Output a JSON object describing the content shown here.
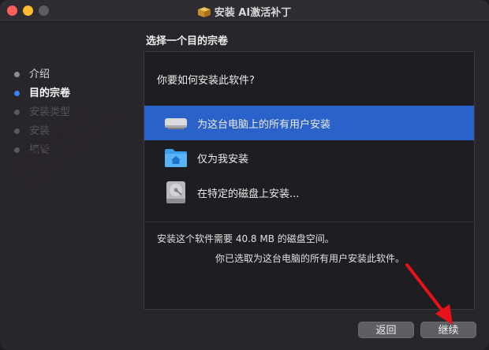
{
  "window": {
    "title": "安装 AI激活补丁"
  },
  "page_title": "选择一个目的宗卷",
  "steps": [
    {
      "label": "介绍",
      "state": "done"
    },
    {
      "label": "目的宗卷",
      "state": "active"
    },
    {
      "label": "安装类型",
      "state": "pending"
    },
    {
      "label": "安装",
      "state": "pending"
    },
    {
      "label": "摘要",
      "state": "pending"
    }
  ],
  "panel": {
    "question": "你要如何安装此软件?",
    "options": [
      {
        "label": "为这台电脑上的所有用户安装",
        "icon": "computer-icon",
        "selected": true
      },
      {
        "label": "仅为我安装",
        "icon": "home-folder-icon",
        "selected": false
      },
      {
        "label": "在特定的磁盘上安装...",
        "icon": "disk-icon",
        "selected": false
      }
    ],
    "info_size": "安装这个软件需要 40.8 MB 的磁盘空间。",
    "info_choice": "你已选取为这台电脑的所有用户安装此软件。"
  },
  "buttons": {
    "back": "返回",
    "continue": "继续"
  },
  "watermark": {
    "line1": "迈克软件 软仓云",
    "line2": "ruancnagyun.cn"
  },
  "colors": {
    "accent": "#2a62c9",
    "step_active_dot": "#3a82f7",
    "annotation_arrow": "#e8121a"
  }
}
